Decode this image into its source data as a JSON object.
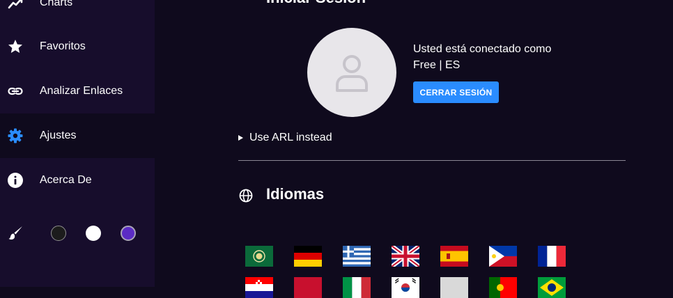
{
  "sidebar": {
    "items": [
      {
        "label": "Charts",
        "icon": "chart-icon"
      },
      {
        "label": "Favoritos",
        "icon": "star-icon"
      },
      {
        "label": "Analizar Enlaces",
        "icon": "link-icon"
      },
      {
        "label": "Ajustes",
        "icon": "gear-icon"
      },
      {
        "label": "Acerca De",
        "icon": "info-icon"
      }
    ],
    "theme": {
      "icon": "brush-icon",
      "swatches": [
        "#1c1c1c",
        "#ffffff",
        "#5b2bc4"
      ]
    }
  },
  "login": {
    "section_title": "Iniciar Sesión",
    "connected_as": "Usted está conectado como",
    "account": "Free | ES",
    "logout_label": "CERRAR SESIÓN",
    "arl_toggle": "Use ARL instead"
  },
  "languages": {
    "title": "Idiomas",
    "icon": "globe-icon",
    "flags": [
      "arabic",
      "german",
      "greek",
      "english",
      "spanish",
      "filipino",
      "french",
      "croatian",
      "other",
      "italian",
      "korean",
      "other",
      "portuguese",
      "brazilian"
    ]
  },
  "colors": {
    "accent": "#2a8cff",
    "sidebar_bg": "#170d2c",
    "main_bg": "#0f0a1d"
  }
}
